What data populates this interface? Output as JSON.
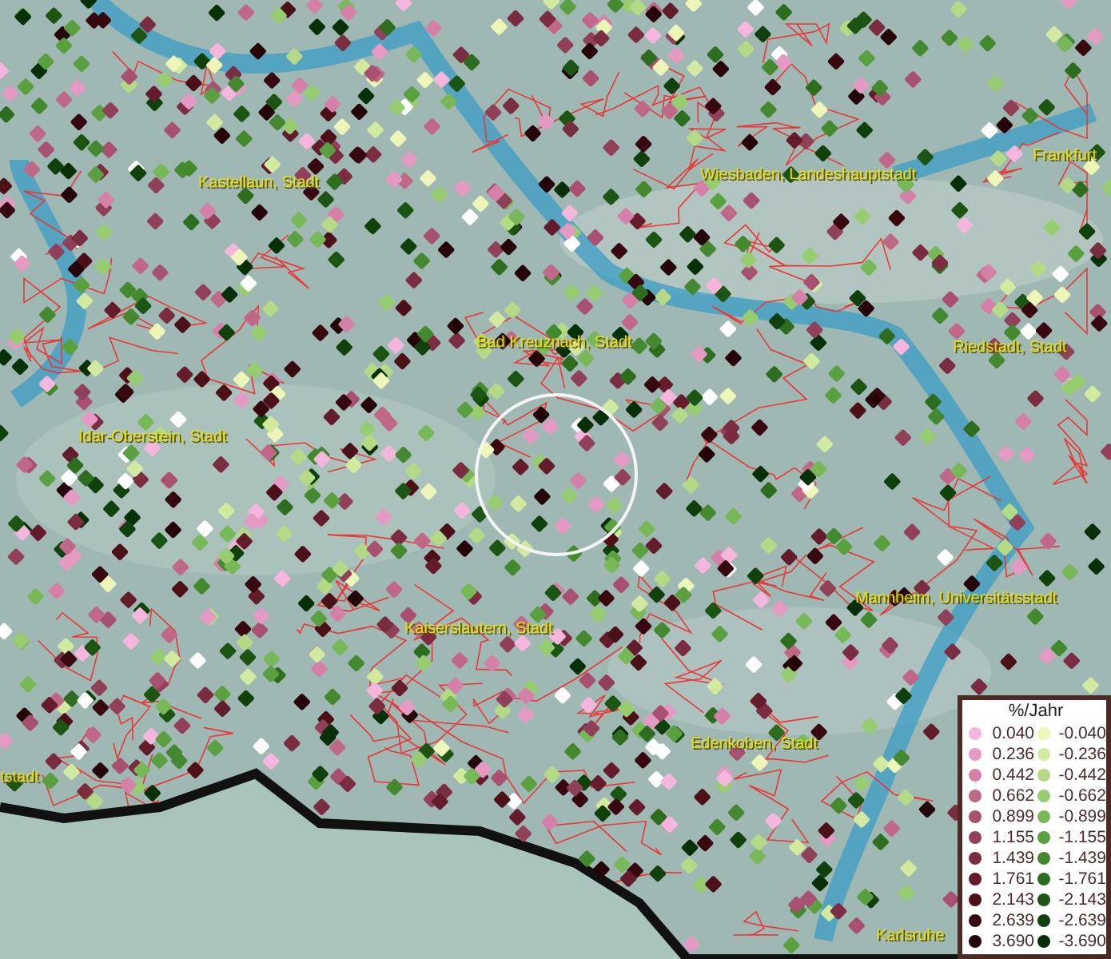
{
  "map": {
    "places": [
      {
        "name": "Frankfurt"
      },
      {
        "name": "Kastellaun, Stadt"
      },
      {
        "name": "Wiesbaden, Landeshauptstadt"
      },
      {
        "name": "Bad Kreuznach, Stadt"
      },
      {
        "name": "Riedstadt, Stadt"
      },
      {
        "name": "Idar-Oberstein, Stadt"
      },
      {
        "name": "Mannheim, Universitätsstadt"
      },
      {
        "name": "Kaiserslautern, Stadt"
      },
      {
        "name": "Edenkoben, Stadt"
      },
      {
        "name": "tstadt"
      },
      {
        "name": "Karlsruhe"
      }
    ]
  },
  "legend": {
    "title": "%/Jahr",
    "rows": [
      {
        "positive": {
          "label": "0.040",
          "color": "#f4b6dc"
        },
        "negative": {
          "label": "-0.040",
          "color": "#eef5b8"
        }
      },
      {
        "positive": {
          "label": "0.236",
          "color": "#e59ac4"
        },
        "negative": {
          "label": "-0.236",
          "color": "#d2eaa0"
        }
      },
      {
        "positive": {
          "label": "0.442",
          "color": "#d480a8"
        },
        "negative": {
          "label": "-0.442",
          "color": "#b4da88"
        }
      },
      {
        "positive": {
          "label": "0.662",
          "color": "#c06888"
        },
        "negative": {
          "label": "-0.662",
          "color": "#98cc70"
        }
      },
      {
        "positive": {
          "label": "0.899",
          "color": "#a85070"
        },
        "negative": {
          "label": "-0.899",
          "color": "#78b858"
        }
      },
      {
        "positive": {
          "label": "1.155",
          "color": "#904058"
        },
        "negative": {
          "label": "-1.155",
          "color": "#5aa040"
        }
      },
      {
        "positive": {
          "label": "1.439",
          "color": "#7a2c40"
        },
        "negative": {
          "label": "-1.439",
          "color": "#448830"
        }
      },
      {
        "positive": {
          "label": "1.761",
          "color": "#641c2c"
        },
        "negative": {
          "label": "-1.761",
          "color": "#2e6c20"
        }
      },
      {
        "positive": {
          "label": "2.143",
          "color": "#4c1018"
        },
        "negative": {
          "label": "-2.143",
          "color": "#1c5414"
        }
      },
      {
        "positive": {
          "label": "2.639",
          "color": "#380810"
        },
        "negative": {
          "label": "-2.639",
          "color": "#10400c"
        }
      },
      {
        "positive": {
          "label": "3.690",
          "color": "#240408"
        },
        "negative": {
          "label": "-3.690",
          "color": "#083008"
        }
      }
    ]
  }
}
